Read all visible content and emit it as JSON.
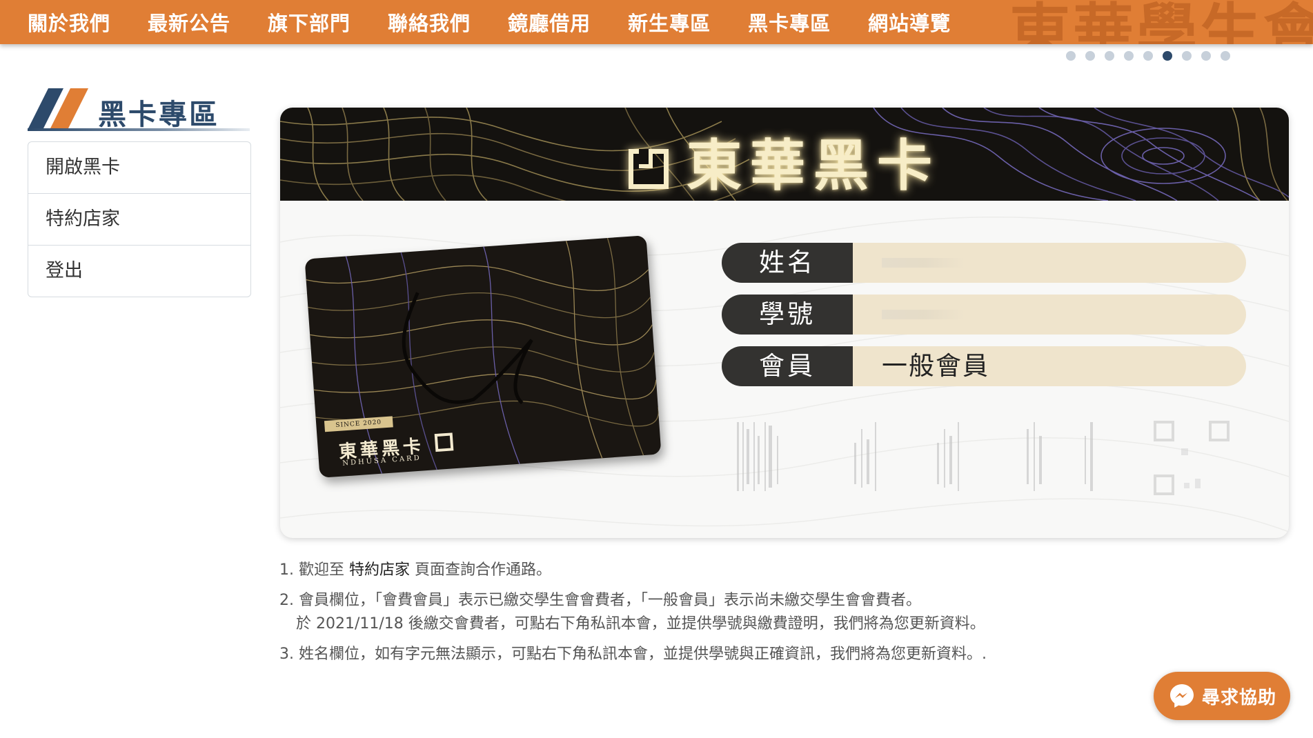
{
  "nav": {
    "items": [
      "關於我們",
      "最新公告",
      "旗下部門",
      "聯絡我們",
      "鏡廳借用",
      "新生專區",
      "黑卡專區",
      "網站導覽"
    ],
    "watermark": "東華學生會",
    "carousel_dot_count": 9,
    "carousel_active_index": 5
  },
  "sidebar": {
    "title": "黑卡專區",
    "items": [
      {
        "label": "開啟黑卡"
      },
      {
        "label": "特約店家"
      },
      {
        "label": "登出"
      }
    ]
  },
  "card": {
    "header_title": "東華黑卡",
    "image": {
      "since": "SINCE 2020",
      "name": "東華黑卡",
      "subtitle": "NDHUSA CARD"
    },
    "fields": [
      {
        "label": "姓名",
        "value": "",
        "redacted": true
      },
      {
        "label": "學號",
        "value": "",
        "redacted": true
      },
      {
        "label": "會員",
        "value": "一般會員",
        "redacted": false
      }
    ]
  },
  "notes": {
    "n1_prefix": "1. 歡迎至 ",
    "n1_link": "特約店家",
    "n1_suffix": " 頁面查詢合作通路。",
    "n2_line1": "2. 會員欄位，「會費會員」表示已繳交學生會會費者，「一般會員」表示尚未繳交學生會會費者。",
    "n2_line2": "於 2021/11/18 後繳交會費者，可點右下角私訊本會，並提供學號與繳費證明，我們將為您更新資料。",
    "n3": "3. 姓名欄位，如有字元無法顯示，可點右下角私訊本會，並提供學號與正確資訊，我們將為您更新資料。."
  },
  "help_button": {
    "label": "尋求協助",
    "icon": "messenger-icon"
  },
  "colors": {
    "nav_bg": "#e07e35",
    "sidebar_title": "#2d4a6b",
    "card_header": "#14120f",
    "field_label_bg": "#333230",
    "field_value_bg": "#efe4cc"
  }
}
